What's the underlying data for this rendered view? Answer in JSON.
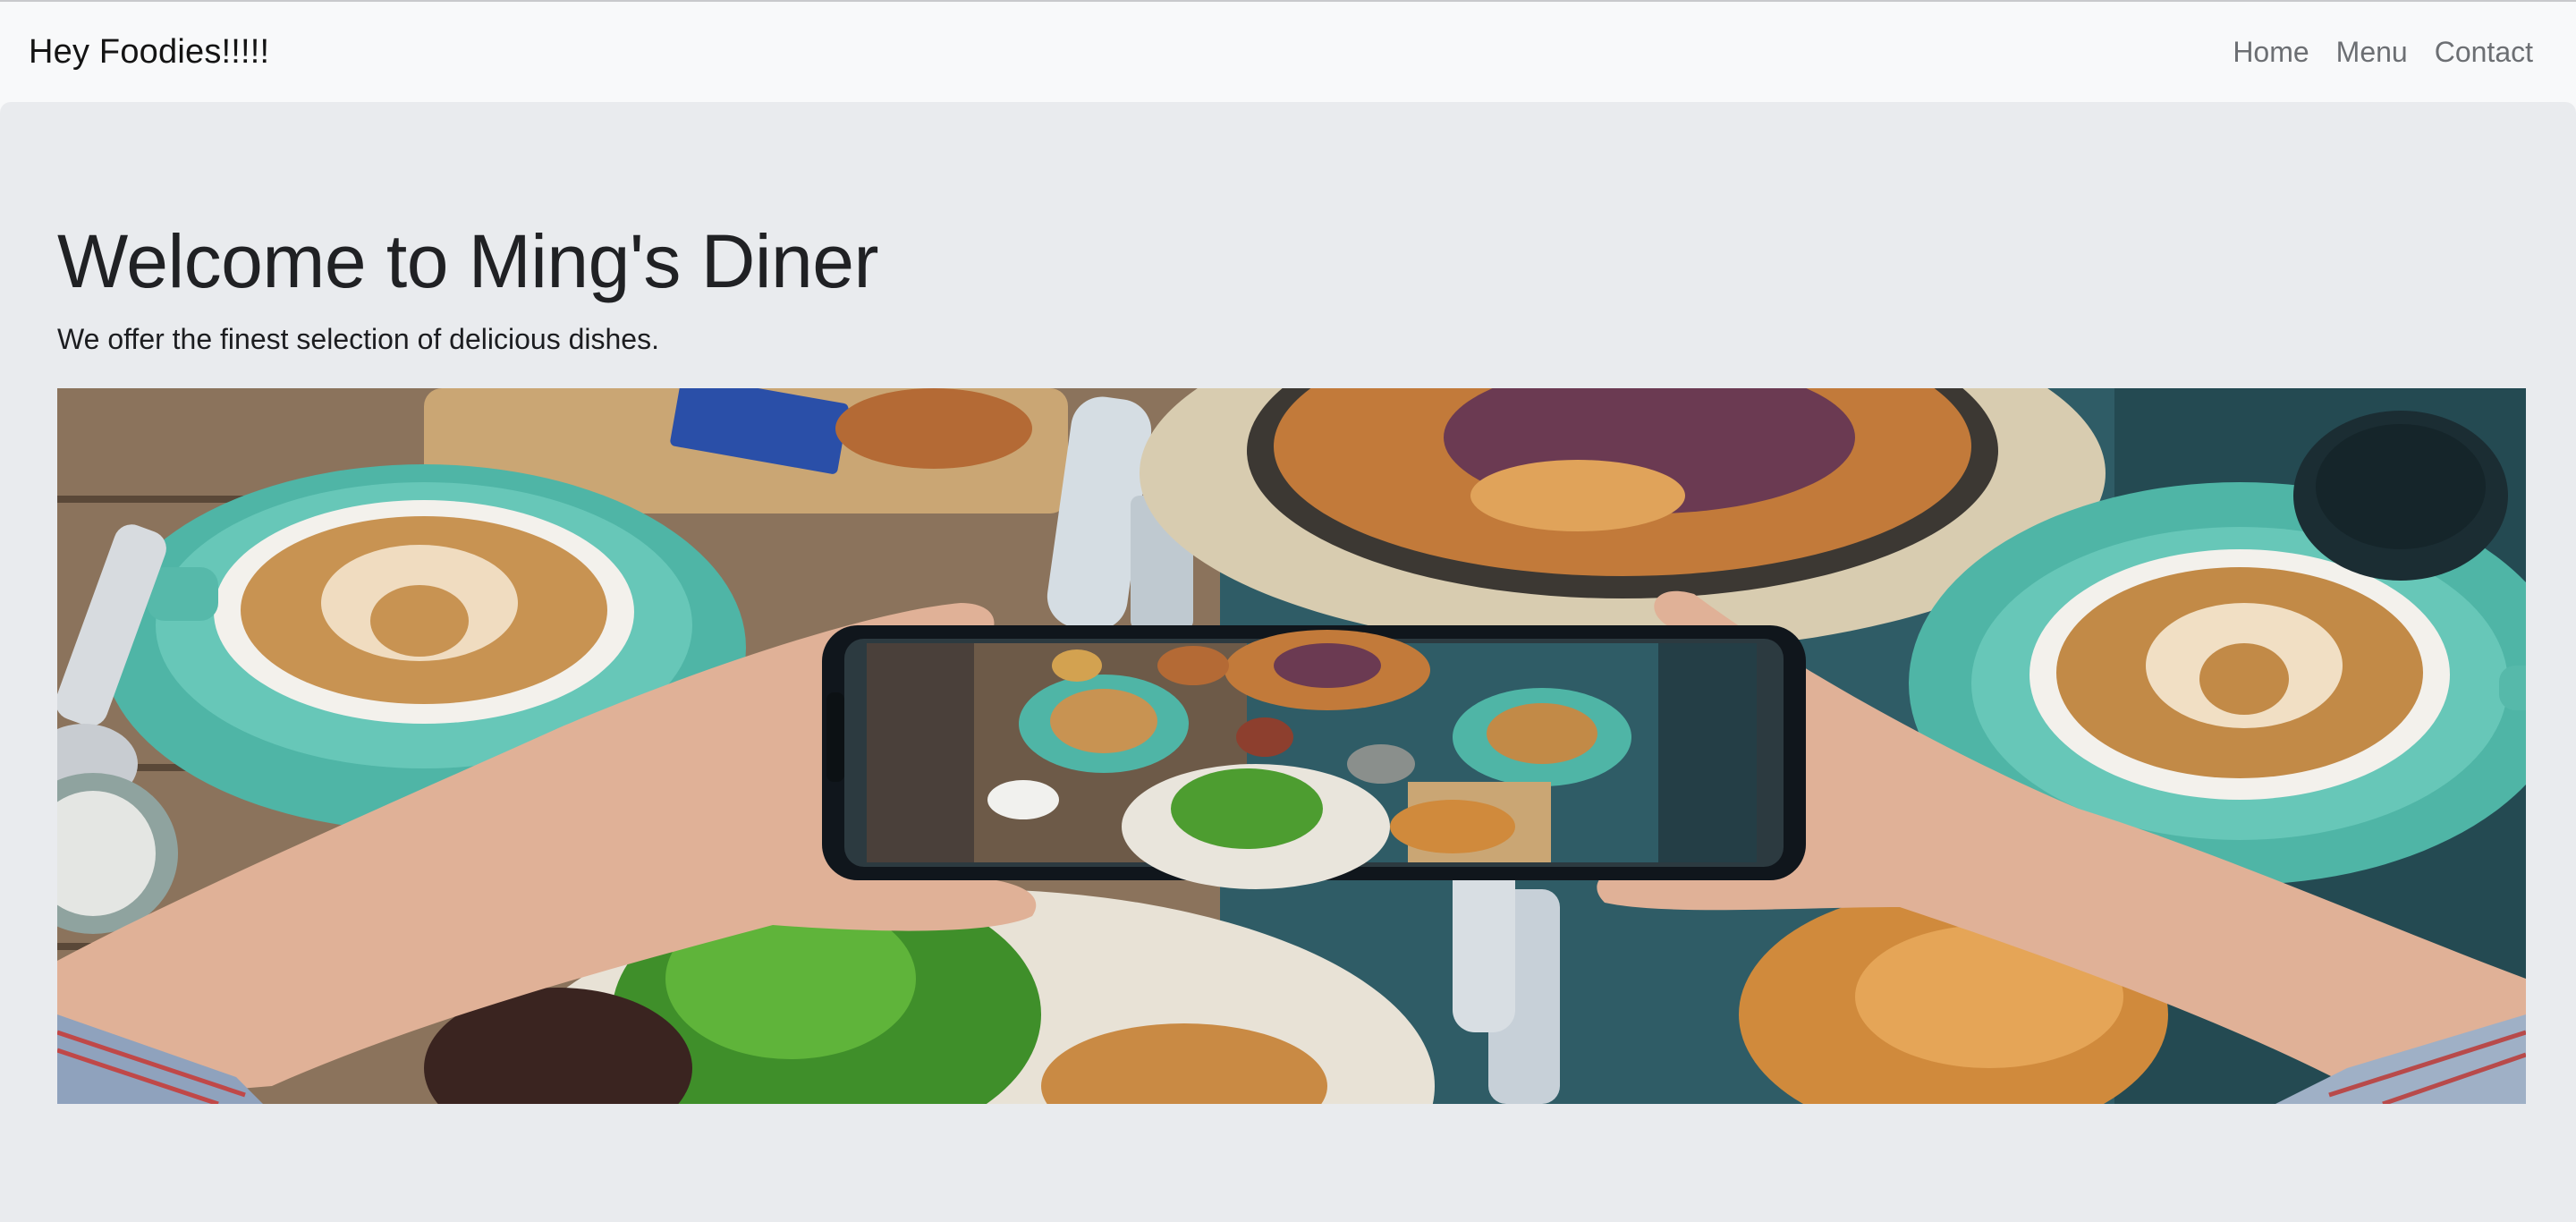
{
  "navbar": {
    "brand": "Hey Foodies!!!!!",
    "links": [
      {
        "label": "Home"
      },
      {
        "label": "Menu"
      },
      {
        "label": "Contact"
      }
    ]
  },
  "hero": {
    "title": "Welcome to Ming's Diner",
    "subtitle": "We offer the finest selection of delicious dishes."
  },
  "colors": {
    "navbar_bg": "#f8f9fa",
    "jumbotron_bg": "#e9ebee",
    "link": "#6c6f73",
    "title": "#202124"
  }
}
